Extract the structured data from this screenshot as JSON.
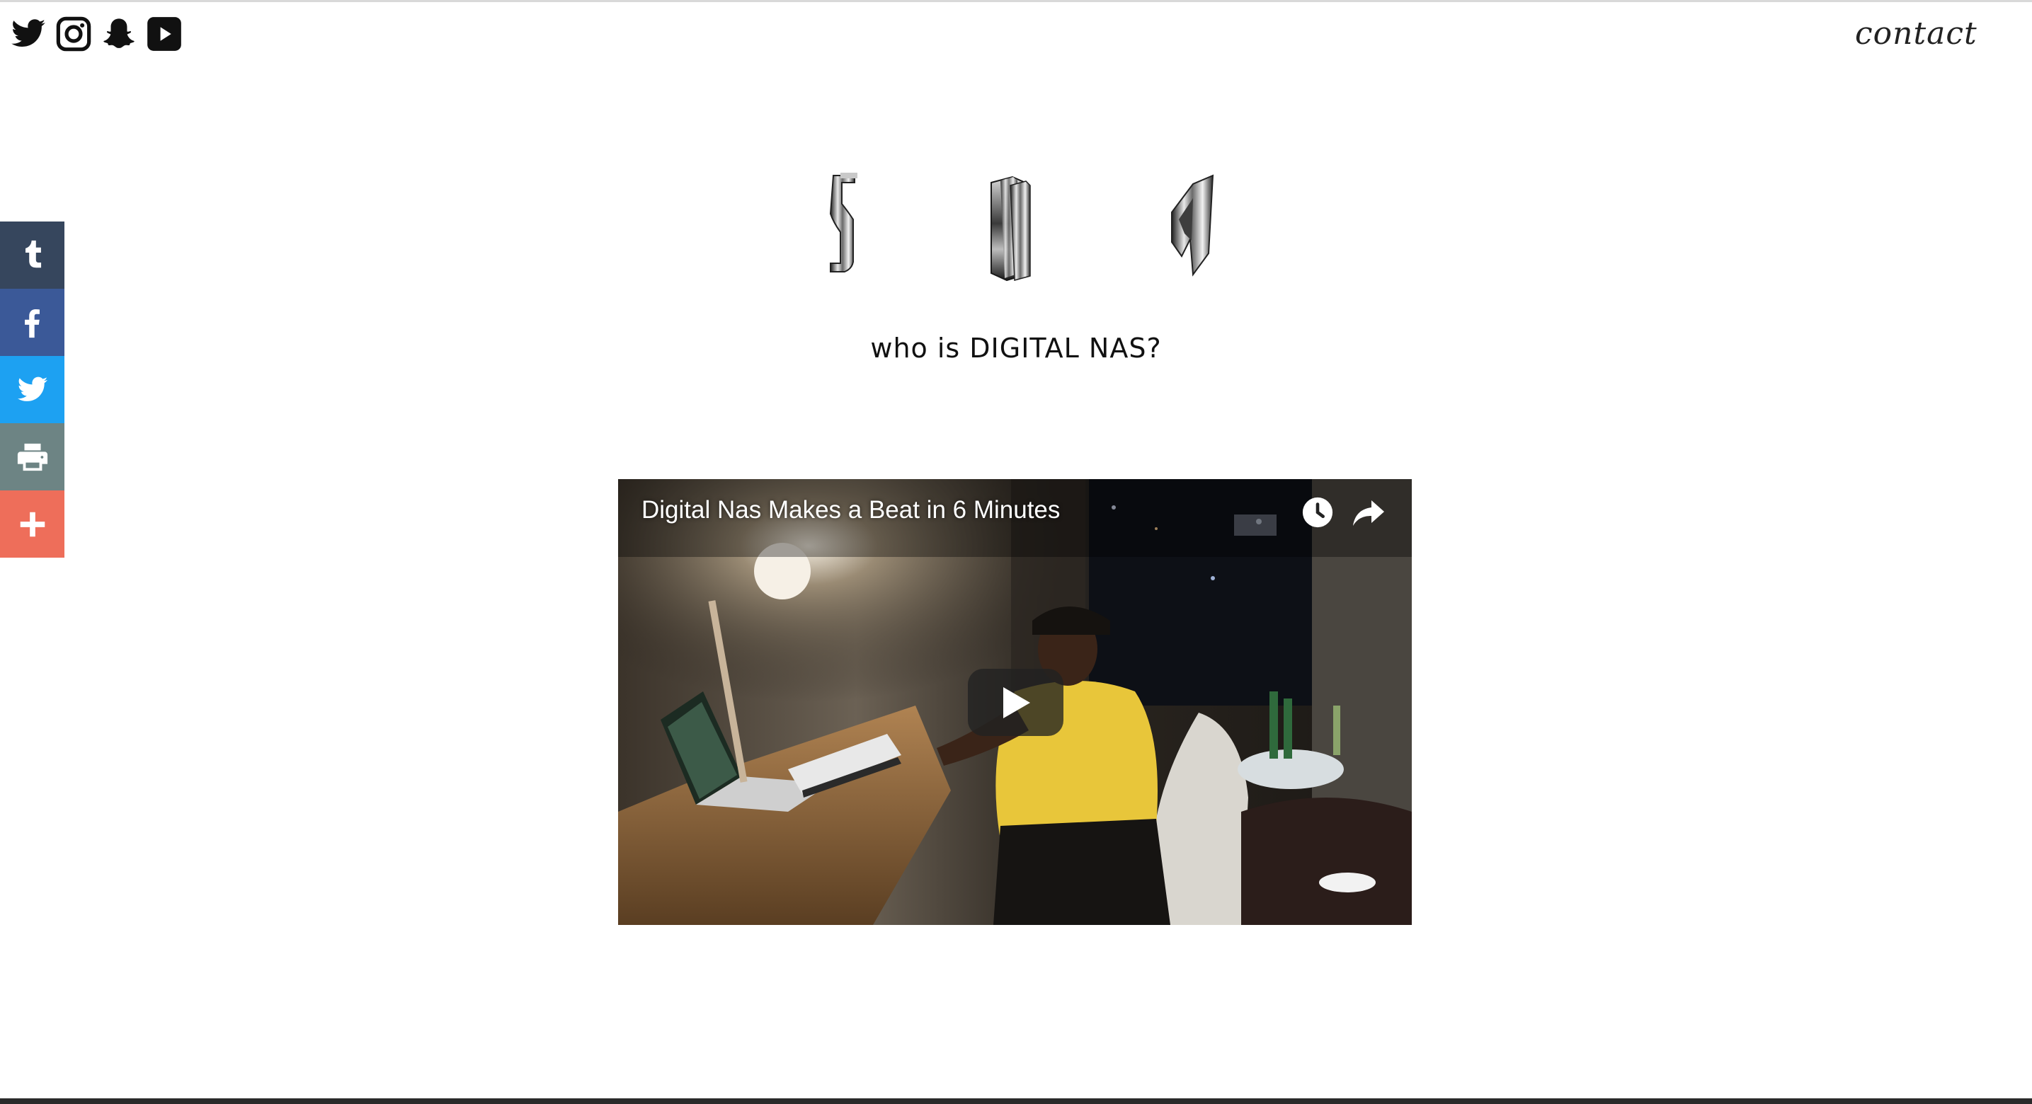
{
  "header": {
    "social_icons": [
      "twitter-icon",
      "instagram-icon",
      "snapchat-icon",
      "youtube-icon"
    ],
    "contact_label": "contact"
  },
  "share_bar": {
    "items": [
      {
        "name": "tumblr",
        "icon": "tumblr-icon",
        "color": "#36465d"
      },
      {
        "name": "facebook",
        "icon": "facebook-icon",
        "color": "#3b5998"
      },
      {
        "name": "twitter",
        "icon": "twitter-icon",
        "color": "#1da1f2"
      },
      {
        "name": "print",
        "icon": "printer-icon",
        "color": "#6d8484"
      },
      {
        "name": "more",
        "icon": "plus-icon",
        "color": "#ee6e5a"
      }
    ]
  },
  "main": {
    "tagline": "who is DIGITAL NAS?",
    "video": {
      "title": "Digital Nas Makes a Beat in 6 Minutes"
    }
  }
}
